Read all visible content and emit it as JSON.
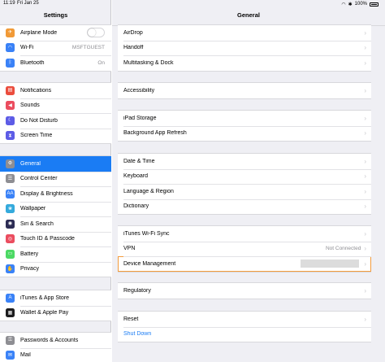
{
  "status": {
    "time": "11:19",
    "date": "Fri Jan 25",
    "battery": "100%"
  },
  "sidebar": {
    "title": "Settings",
    "groups": [
      [
        {
          "label": "Airplane Mode",
          "icon": "airplane-icon",
          "color": "#f19a37",
          "glyph": "✈",
          "toggle": false
        },
        {
          "label": "Wi-Fi",
          "icon": "wifi-icon",
          "color": "#3a82f7",
          "glyph": "◠",
          "value": "MSFTGUEST"
        },
        {
          "label": "Bluetooth",
          "icon": "bluetooth-icon",
          "color": "#3a82f7",
          "glyph": "ᛒ",
          "value": "On"
        }
      ],
      [
        {
          "label": "Notifications",
          "icon": "notifications-icon",
          "color": "#eb4d3d",
          "glyph": "▤"
        },
        {
          "label": "Sounds",
          "icon": "sounds-icon",
          "color": "#eb4d5f",
          "glyph": "◀"
        },
        {
          "label": "Do Not Disturb",
          "icon": "moon-icon",
          "color": "#5d5ce6",
          "glyph": "☾"
        },
        {
          "label": "Screen Time",
          "icon": "hourglass-icon",
          "color": "#5d5ce6",
          "glyph": "⧗"
        }
      ],
      [
        {
          "label": "General",
          "icon": "gear-icon",
          "color": "#8e8e93",
          "glyph": "⚙",
          "selected": true
        },
        {
          "label": "Control Center",
          "icon": "control-center-icon",
          "color": "#8e8e93",
          "glyph": "☰"
        },
        {
          "label": "Display & Brightness",
          "icon": "display-icon",
          "color": "#3a82f7",
          "glyph": "AA"
        },
        {
          "label": "Wallpaper",
          "icon": "wallpaper-icon",
          "color": "#34aadc",
          "glyph": "❀"
        },
        {
          "label": "Siri & Search",
          "icon": "siri-icon",
          "color": "#2c2c54",
          "glyph": "◉"
        },
        {
          "label": "Touch ID & Passcode",
          "icon": "fingerprint-icon",
          "color": "#eb4d5f",
          "glyph": "◎"
        },
        {
          "label": "Battery",
          "icon": "battery-icon",
          "color": "#4cd964",
          "glyph": "▭"
        },
        {
          "label": "Privacy",
          "icon": "hand-icon",
          "color": "#3a82f7",
          "glyph": "✋"
        }
      ],
      [
        {
          "label": "iTunes & App Store",
          "icon": "app-store-icon",
          "color": "#3a82f7",
          "glyph": "A"
        },
        {
          "label": "Wallet & Apple Pay",
          "icon": "wallet-icon",
          "color": "#1c1c1e",
          "glyph": "▦"
        }
      ],
      [
        {
          "label": "Passwords & Accounts",
          "icon": "key-icon",
          "color": "#8e8e93",
          "glyph": "⚿"
        },
        {
          "label": "Mail",
          "icon": "mail-icon",
          "color": "#3a82f7",
          "glyph": "✉"
        }
      ]
    ]
  },
  "detail": {
    "title": "General",
    "groups": [
      [
        {
          "label": "AirDrop"
        },
        {
          "label": "Handoff"
        },
        {
          "label": "Multitasking & Dock"
        }
      ],
      [
        {
          "label": "Accessibility"
        }
      ],
      [
        {
          "label": "iPad Storage"
        },
        {
          "label": "Background App Refresh"
        }
      ],
      [
        {
          "label": "Date & Time"
        },
        {
          "label": "Keyboard"
        },
        {
          "label": "Language & Region"
        },
        {
          "label": "Dictionary"
        }
      ],
      [
        {
          "label": "iTunes Wi-Fi Sync"
        },
        {
          "label": "VPN",
          "value": "Not Connected"
        },
        {
          "label": "Device Management",
          "redacted": true,
          "highlight": true
        }
      ],
      [
        {
          "label": "Regulatory"
        }
      ],
      [
        {
          "label": "Reset"
        },
        {
          "label": "Shut Down",
          "link": true,
          "nochev": true
        }
      ]
    ]
  }
}
